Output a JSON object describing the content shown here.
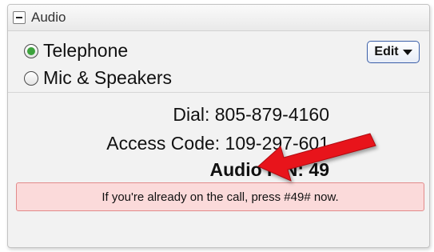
{
  "panel": {
    "title": "Audio"
  },
  "audio_options": {
    "telephone_label": "Telephone",
    "mic_label": "Mic & Speakers",
    "selected": "Telephone",
    "edit_label": "Edit"
  },
  "call_info": {
    "dial_text": "Dial: 805-879-4160",
    "access_code_text": "Access Code: 109-297-601",
    "pin_text": "Audio PIN: 49"
  },
  "notice": {
    "text": "If you're already on the call, press #49# now."
  },
  "colors": {
    "notice_bg": "#fbdada",
    "notice_border": "#e28a8a",
    "annotation_arrow": "#e8141b",
    "radio_selected": "#3da33d",
    "edit_border": "#3b5fa8"
  },
  "icons": {
    "collapse": "minus-icon",
    "edit_dropdown": "caret-down-icon",
    "annotation": "red-arrow-icon"
  }
}
